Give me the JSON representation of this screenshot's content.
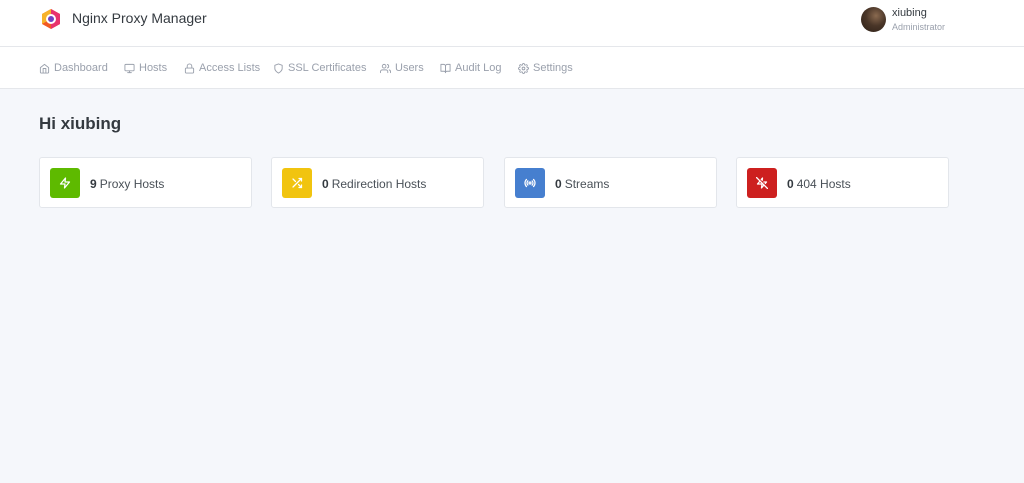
{
  "app": {
    "title": "Nginx Proxy Manager"
  },
  "user": {
    "name": "xiubing",
    "role": "Administrator"
  },
  "nav": {
    "items": [
      {
        "label": "Dashboard",
        "icon": "home-icon"
      },
      {
        "label": "Hosts",
        "icon": "monitor-icon"
      },
      {
        "label": "Access Lists",
        "icon": "lock-icon"
      },
      {
        "label": "SSL Certificates",
        "icon": "shield-icon"
      },
      {
        "label": "Users",
        "icon": "users-icon"
      },
      {
        "label": "Audit Log",
        "icon": "book-icon"
      },
      {
        "label": "Settings",
        "icon": "gear-icon"
      }
    ]
  },
  "main": {
    "greeting": "Hi xiubing",
    "cards": [
      {
        "count": "9",
        "label": "Proxy Hosts",
        "icon": "zap-icon",
        "color": "#5eba00"
      },
      {
        "count": "0",
        "label": "Redirection Hosts",
        "icon": "shuffle-icon",
        "color": "#f1c40f"
      },
      {
        "count": "0",
        "label": "Streams",
        "icon": "radio-icon",
        "color": "#467fcf"
      },
      {
        "count": "0",
        "label": "404 Hosts",
        "icon": "zap-off-icon",
        "color": "#cd201f"
      }
    ]
  }
}
